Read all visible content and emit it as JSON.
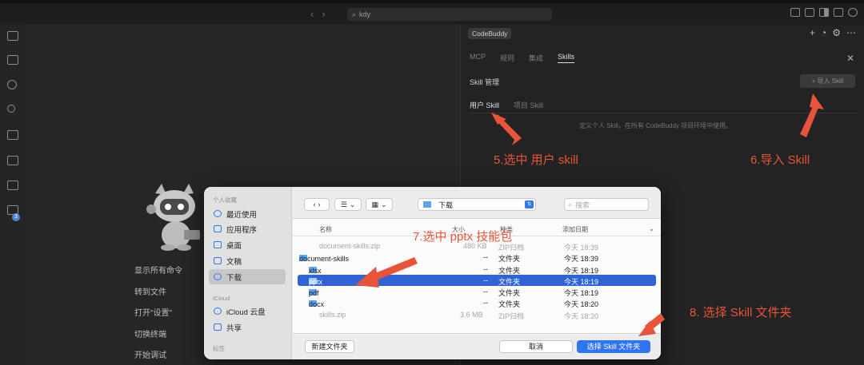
{
  "titlebar": {
    "search": "kdy"
  },
  "welcome": {
    "items": [
      "显示所有命令",
      "转到文件",
      "打开\"设置\"",
      "切换终端",
      "开始调试"
    ]
  },
  "activity": {
    "badge": "3"
  },
  "panel": {
    "brand": "CodeBuddy",
    "tabs": [
      "MCP",
      "规则",
      "集成",
      "Skills"
    ],
    "active_tab": "Skills",
    "section_title": "Skill 管理",
    "import_label": "+ 导入 Skill",
    "subtabs": [
      "用户 Skill",
      "项目 Skill"
    ],
    "hint": "定义个人 Skill，在所有 CodeBuddy 项目环境中使用。"
  },
  "annotations": {
    "a5": "5.选中 用户 skill",
    "a6": "6.导入 Skill",
    "a7": "7.选中 pptx 技能包",
    "a8": "8. 选择 Skill 文件夹",
    "color": "#e8543a"
  },
  "dialog": {
    "sidebar": {
      "favorites_header": "个人收藏",
      "favorites": [
        "最近使用",
        "应用程序",
        "桌面",
        "文稿",
        "下载"
      ],
      "selected": "下载",
      "icloud_header": "iCloud",
      "icloud": [
        "iCloud 云盘",
        "共享"
      ],
      "tags_header": "标签"
    },
    "location": "下载",
    "search_placeholder": "搜索",
    "columns": {
      "name": "名称",
      "size": "大小",
      "kind": "种类",
      "date": "添加日期"
    },
    "rows": [
      {
        "name": "document-skills.zip",
        "size": "480 KB",
        "kind": "ZIP归档",
        "date": "今天 18:39",
        "dim": true
      },
      {
        "name": "document-skills",
        "size": "--",
        "kind": "文件夹",
        "date": "今天 18:39",
        "expanded": true
      },
      {
        "name": "xlsx",
        "size": "--",
        "kind": "文件夹",
        "date": "今天 18:19"
      },
      {
        "name": "pptx",
        "size": "--",
        "kind": "文件夹",
        "date": "今天 18:19",
        "selected": true
      },
      {
        "name": "pdf",
        "size": "--",
        "kind": "文件夹",
        "date": "今天 18:19"
      },
      {
        "name": "docx",
        "size": "--",
        "kind": "文件夹",
        "date": "今天 18:20"
      },
      {
        "name": "skills.zip",
        "size": "3.6 MB",
        "kind": "ZIP归档",
        "date": "今天 18:20",
        "dim": true
      }
    ],
    "new_folder": "新建文件夹",
    "cancel": "取消",
    "confirm": "选择 Skill 文件夹"
  }
}
